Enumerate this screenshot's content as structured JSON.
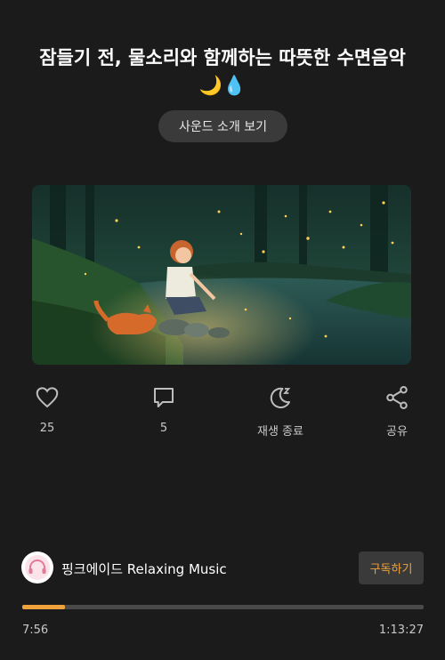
{
  "title": "잠들기 전, 물소리와 함께하는 따뜻한 수면음악 🌙💧",
  "intro_button": "사운드 소개 보기",
  "actions": {
    "like": {
      "icon": "heart-icon",
      "label": "25"
    },
    "comment": {
      "icon": "comment-icon",
      "label": "5"
    },
    "sleep_timer": {
      "icon": "moon-sleep-icon",
      "label": "재생 종료"
    },
    "share": {
      "icon": "share-icon",
      "label": "공유"
    }
  },
  "channel": {
    "name": "핑크에이드 Relaxing Music",
    "subscribe": "구독하기"
  },
  "player": {
    "current_time": "7:56",
    "total_time": "1:13:27",
    "progress": 0.107
  },
  "colors": {
    "background": "#1b1b1b",
    "accent": "#f0a23a",
    "button_bg": "#3a3a3a"
  }
}
